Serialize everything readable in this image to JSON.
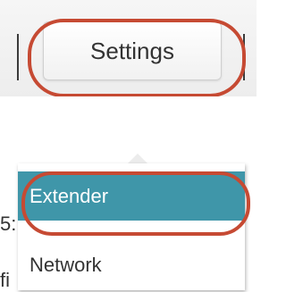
{
  "header": {
    "settings_tab_label": "Settings"
  },
  "menu": {
    "items": [
      {
        "label": "Extender",
        "state": "active"
      },
      {
        "label": "Network",
        "state": "default"
      }
    ]
  },
  "colors": {
    "accent": "#3f96a9",
    "highlight_annotation": "#c64a33"
  }
}
